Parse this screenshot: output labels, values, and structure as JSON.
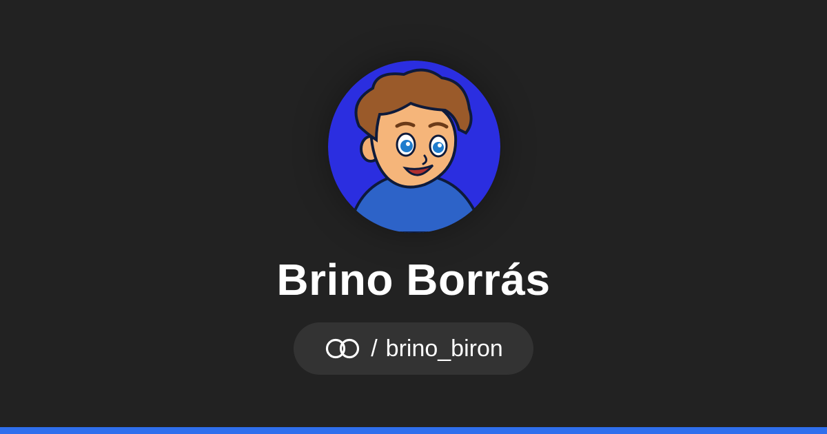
{
  "profile": {
    "name": "Brino Borrás",
    "separator": "/",
    "username": "brino_biron",
    "avatar_icon": "cartoon-boy-avatar",
    "brand_icon": "interlocked-rings-icon"
  },
  "colors": {
    "background": "#222222",
    "pill": "#333333",
    "text": "#ffffff",
    "avatar_bg": "#2b2ee0",
    "accent_bar": "#2f6fed"
  }
}
